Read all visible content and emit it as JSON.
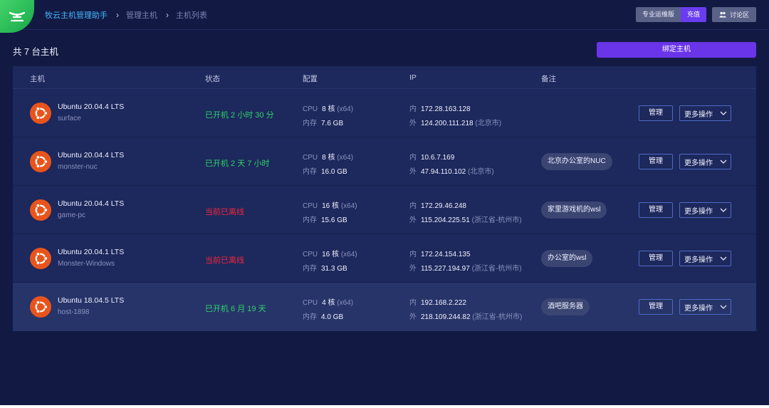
{
  "breadcrumb": [
    "牧云主机管理助手",
    "管理主机",
    "主机列表"
  ],
  "top_right": {
    "edition_label": "专业运维版",
    "recharge_label": "充值",
    "discuss_label": "讨论区"
  },
  "summary": {
    "count_text": "共 7 台主机"
  },
  "bind_button": "绑定主机",
  "table": {
    "headers": [
      "主机",
      "状态",
      "配置",
      "IP",
      "备注"
    ],
    "rows": [
      {
        "os": "Ubuntu 20.04.4 LTS",
        "hostname": "surface",
        "status": "已开机 2 小时 30 分",
        "cpu_label": "CPU",
        "cpu": "8 核",
        "arch": "(x64)",
        "mem_label": "内存",
        "mem": "7.6 GB",
        "ip_in_label": "内",
        "ip_in": "172.28.163.128",
        "ip_out_label": "外",
        "ip_out": "124.200.111.218",
        "ip_loc": "(北京市)",
        "note": "",
        "manage": "管理",
        "more": "更多操作"
      },
      {
        "os": "Ubuntu 20.04.4 LTS",
        "hostname": "monster-nuc",
        "status": "已开机 2 天 7 小时",
        "cpu_label": "CPU",
        "cpu": "8 核",
        "arch": "(x64)",
        "mem_label": "内存",
        "mem": "16.0 GB",
        "ip_in_label": "内",
        "ip_in": "10.6.7.169",
        "ip_out_label": "外",
        "ip_out": "47.94.110.102",
        "ip_loc": "(北京市)",
        "note": "北京办公室的NUC",
        "manage": "管理",
        "more": "更多操作"
      },
      {
        "os": "Ubuntu 20.04.4 LTS",
        "hostname": "game-pc",
        "status": "当前已离线",
        "cpu_label": "CPU",
        "cpu": "16 核",
        "arch": "(x64)",
        "mem_label": "内存",
        "mem": "15.6 GB",
        "ip_in_label": "内",
        "ip_in": "172.29.46.248",
        "ip_out_label": "外",
        "ip_out": "115.204.225.51",
        "ip_loc": "(浙江省-杭州市)",
        "note": "家里游戏机的wsl",
        "manage": "管理",
        "more": "更多操作"
      },
      {
        "os": "Ubuntu 20.04.1 LTS",
        "hostname": "Monster-Windows",
        "status": "当前已离线",
        "cpu_label": "CPU",
        "cpu": "16 核",
        "arch": "(x64)",
        "mem_label": "内存",
        "mem": "31.3 GB",
        "ip_in_label": "内",
        "ip_in": "172.24.154.135",
        "ip_out_label": "外",
        "ip_out": "115.227.194.97",
        "ip_loc": "(浙江省-杭州市)",
        "note": "办公室的wsl",
        "manage": "管理",
        "more": "更多操作"
      },
      {
        "os": "Ubuntu 18.04.5 LTS",
        "hostname": "host-1898",
        "status": "已开机 6 月 19 天",
        "cpu_label": "CPU",
        "cpu": "4 核",
        "arch": "(x64)",
        "mem_label": "内存",
        "mem": "4.0 GB",
        "ip_in_label": "内",
        "ip_in": "192.168.2.222",
        "ip_out_label": "外",
        "ip_out": "218.109.244.82",
        "ip_loc": "(浙江省-杭州市)",
        "note": "酒吧服务器",
        "manage": "管理",
        "more": "更多操作"
      }
    ]
  },
  "colors": {
    "online": "#2fd36b",
    "offline": "#f0273a",
    "accent": "#6a34e8",
    "os_icon": "#e9541c"
  },
  "icons": {
    "logo": "app-logo-icon",
    "os": "ubuntu-icon",
    "discuss": "users-icon",
    "more": "chevron-down-icon",
    "sep": "chevron-right-icon"
  }
}
